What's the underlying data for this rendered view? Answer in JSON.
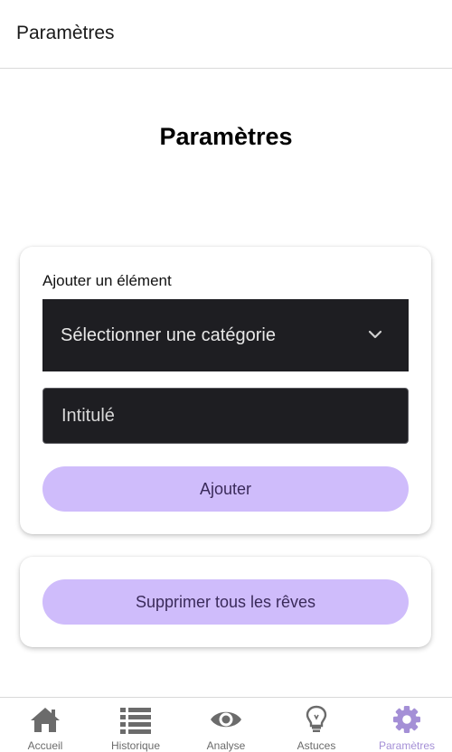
{
  "header": {
    "title": "Paramètres"
  },
  "main": {
    "title": "Paramètres",
    "add_card": {
      "label": "Ajouter un élément",
      "category_select": {
        "selected": "Sélectionner une catégorie"
      },
      "title_input": {
        "placeholder": "Intitulé",
        "value": ""
      },
      "add_button": "Ajouter"
    },
    "delete_card": {
      "delete_button": "Supprimer tous les rêves"
    }
  },
  "bottom_nav": {
    "items": [
      {
        "label": "Accueil",
        "icon": "home-icon"
      },
      {
        "label": "Historique",
        "icon": "list-icon"
      },
      {
        "label": "Analyse",
        "icon": "eye-icon"
      },
      {
        "label": "Astuces",
        "icon": "lightbulb-icon"
      },
      {
        "label": "Paramètres",
        "icon": "gear-icon",
        "active": true
      }
    ],
    "colors": {
      "inactive": "#6b6b6b",
      "active": "#a48fd6"
    }
  },
  "colors": {
    "accent_button": "#cfbcfb",
    "dark_field": "#1e1e22"
  }
}
